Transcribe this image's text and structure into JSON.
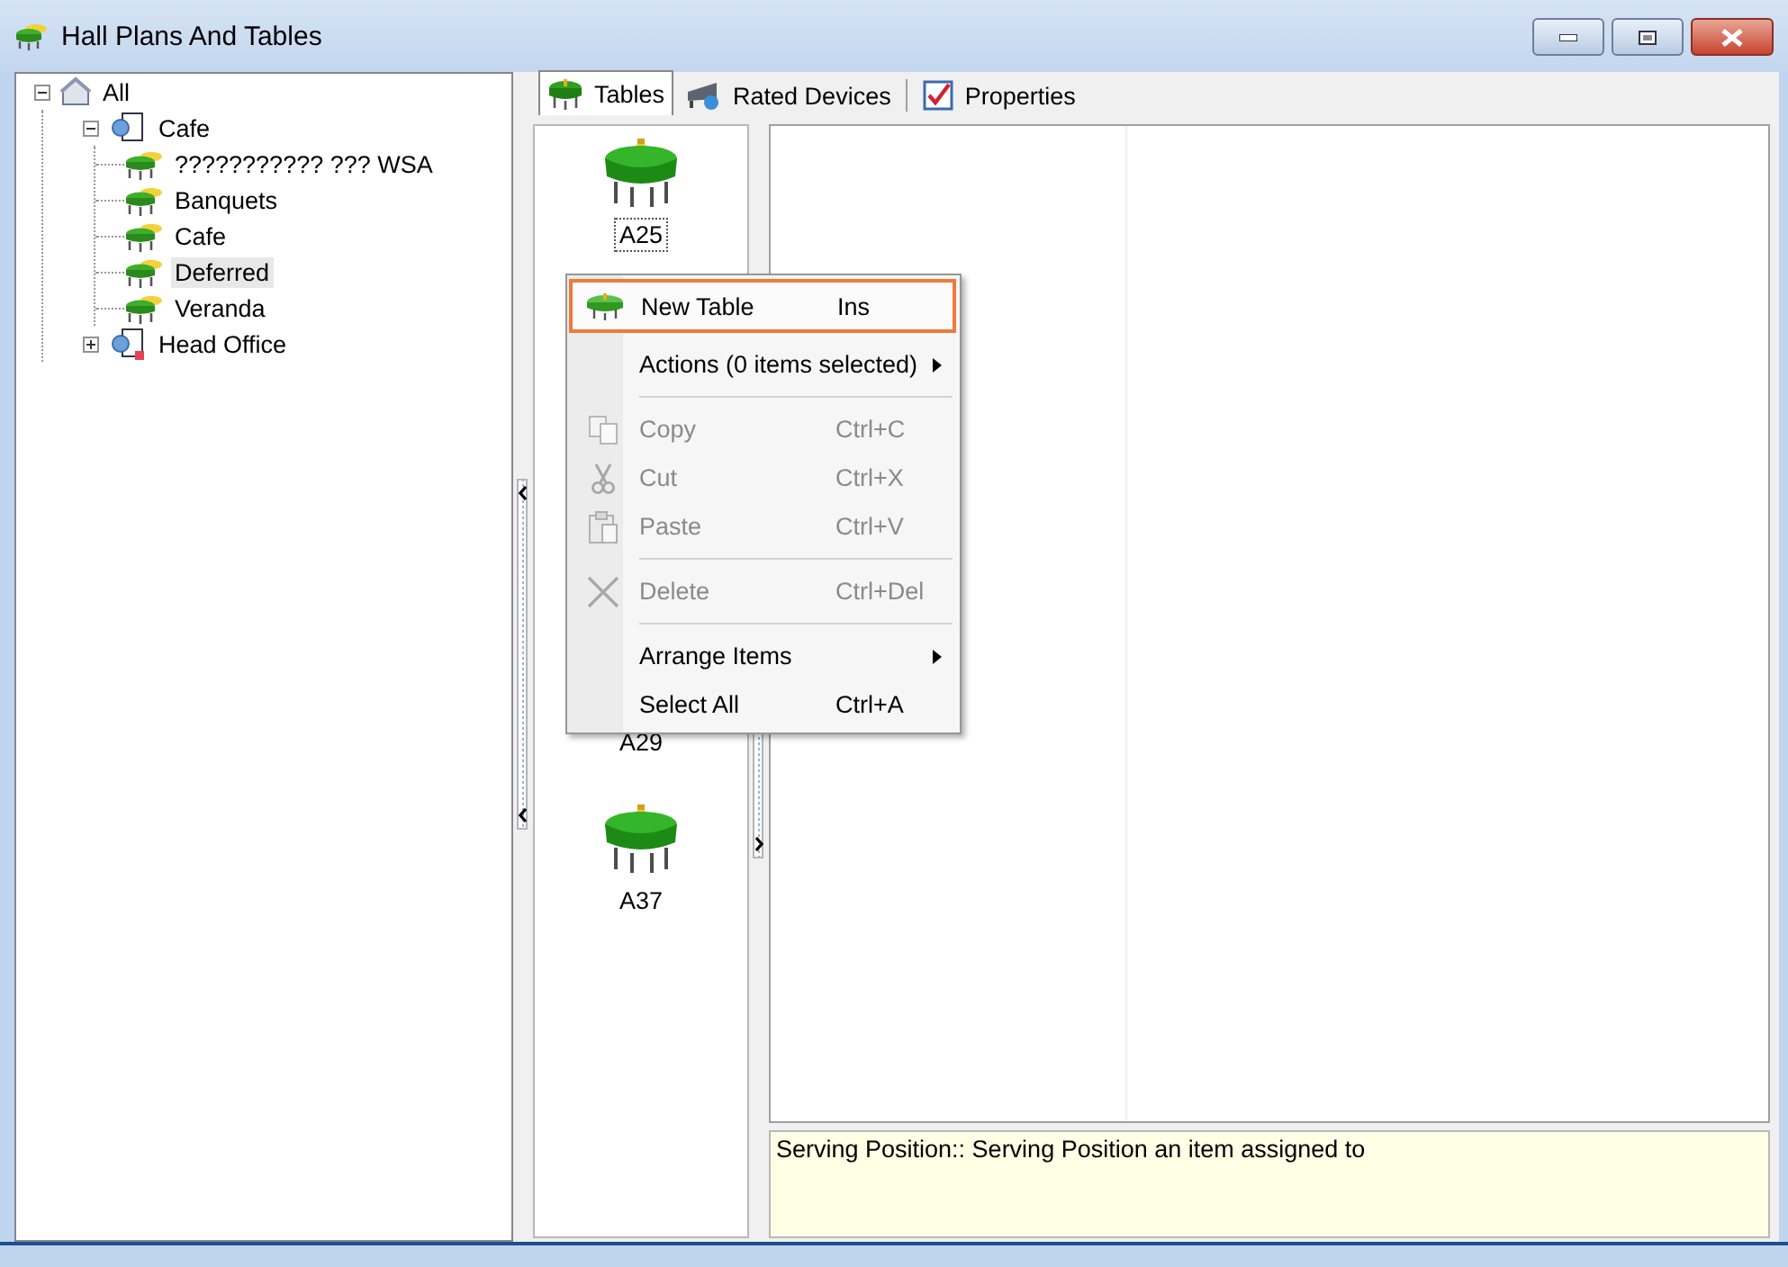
{
  "window": {
    "title": "Hall Plans And Tables"
  },
  "tree": [
    {
      "label": "All",
      "kind": "root",
      "expanded": true,
      "selected": false,
      "children": [
        {
          "label": "Cafe",
          "kind": "place",
          "expanded": true,
          "selected": false,
          "children": [
            {
              "label": "??????????? ??? WSA",
              "kind": "hall",
              "selected": false
            },
            {
              "label": "Banquets",
              "kind": "hall",
              "selected": false
            },
            {
              "label": "Cafe",
              "kind": "hall",
              "selected": false
            },
            {
              "label": "Deferred",
              "kind": "hall",
              "selected": true
            },
            {
              "label": "Veranda",
              "kind": "hall",
              "selected": false
            }
          ]
        },
        {
          "label": "Head Office",
          "kind": "office",
          "expanded": false,
          "selected": false
        }
      ]
    }
  ],
  "tabs": [
    {
      "label": "Tables",
      "kind": "tables",
      "selected": true
    },
    {
      "label": "Rated Devices",
      "kind": "devices",
      "selected": false
    },
    {
      "label": "Properties",
      "kind": "properties",
      "selected": false
    }
  ],
  "tables": [
    {
      "label": "A25",
      "kind": "table",
      "focused": true
    },
    {
      "label": "A29",
      "kind": "label",
      "focused": false
    },
    {
      "label": "A37",
      "kind": "table",
      "focused": false
    }
  ],
  "description": "Serving Position:: Serving Position an item assigned to",
  "context_menu": [
    {
      "kind": "new",
      "label": "New Table",
      "shortcut": "Ins",
      "disabled": false,
      "selected": true,
      "submenu": false
    },
    {
      "kind": "plain",
      "label": "Actions (0 items selected)",
      "disabled": false,
      "selected": false,
      "submenu": true
    },
    {
      "kind": "separator"
    },
    {
      "kind": "copy",
      "label": "Copy",
      "shortcut": "Ctrl+C",
      "disabled": true,
      "selected": false,
      "submenu": false
    },
    {
      "kind": "cut",
      "label": "Cut",
      "shortcut": "Ctrl+X",
      "disabled": true,
      "selected": false,
      "submenu": false
    },
    {
      "kind": "paste",
      "label": "Paste",
      "shortcut": "Ctrl+V",
      "disabled": true,
      "selected": false,
      "submenu": false
    },
    {
      "kind": "separator"
    },
    {
      "kind": "delete",
      "label": "Delete",
      "shortcut": "Ctrl+Del",
      "disabled": true,
      "selected": false,
      "submenu": false
    },
    {
      "kind": "separator"
    },
    {
      "kind": "plain",
      "label": "Arrange Items",
      "disabled": false,
      "selected": false,
      "submenu": true
    },
    {
      "kind": "plain",
      "label": "Select All",
      "shortcut": "Ctrl+A",
      "disabled": false,
      "selected": false,
      "submenu": false
    }
  ]
}
